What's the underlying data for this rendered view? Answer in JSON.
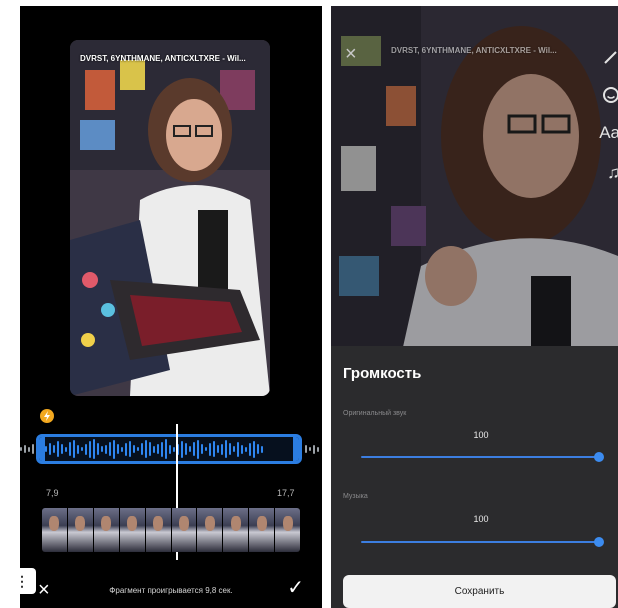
{
  "editor": {
    "track_title": "DVRST, 6YNTHMANE, ANTICXLTXRE - Wil...",
    "start_time": "7,9",
    "end_time": "17,7",
    "fragment_text": "Фрагмент проигрывается 9,8 сек.",
    "close_icon": "×",
    "confirm_icon": "✓"
  },
  "preview": {
    "track_title": "DVRST, 6YNTHMANE, ANTICXLTXRE - Wil...",
    "close_icon": "×",
    "tools": [
      "draw-icon",
      "sticker-icon",
      "text-icon",
      "music-icon"
    ],
    "text_tool_label": "Aa",
    "music_tool_label": "♫"
  },
  "volume_sheet": {
    "title": "Громкость",
    "original_label": "Оригинальный звук",
    "original_value": "100",
    "music_label": "Музыка",
    "music_value": "100",
    "save_label": "Сохранить",
    "original_level": 1.0,
    "music_level": 1.0
  },
  "menu_tab": {
    "label": "⋮"
  },
  "colors": {
    "accent": "#2b7de1",
    "sheet": "#2b2b2d",
    "bolt": "#f2a81f"
  }
}
